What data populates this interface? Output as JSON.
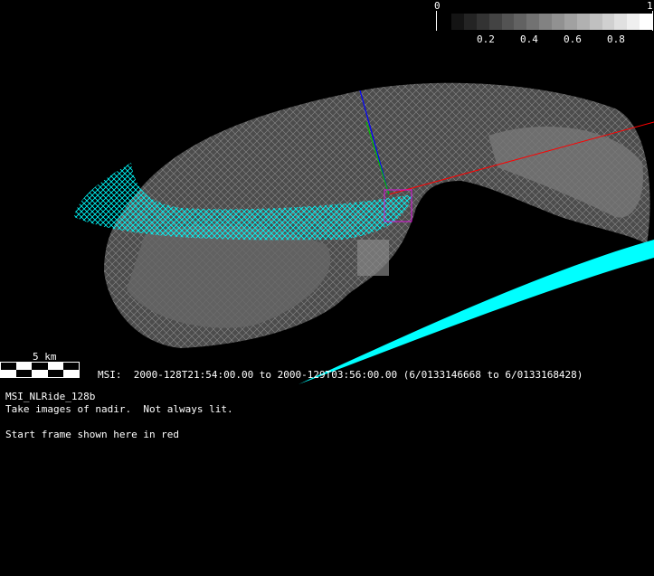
{
  "colorbar": {
    "min_label": "0",
    "max_label": "1",
    "tick_labels": [
      "0.2",
      "0.4",
      "0.6",
      "0.8"
    ],
    "steps": 16
  },
  "scale": {
    "label": "5 km"
  },
  "observation": {
    "instrument_line": "MSI:  2000-128T21:54:00.00 to 2000-129T03:56:00.00 (6/0133146668 to 6/0133168428)",
    "sequence_name": "MSI_NLRide_128b",
    "description": "Take images of nadir.  Not always lit.",
    "note": "Start frame shown here in red"
  },
  "colors": {
    "swath": "#00ffff",
    "start_frame": "#ff0000",
    "axis_x": "#ff0000",
    "axis_y": "#00c000",
    "axis_z": "#0000ff"
  }
}
